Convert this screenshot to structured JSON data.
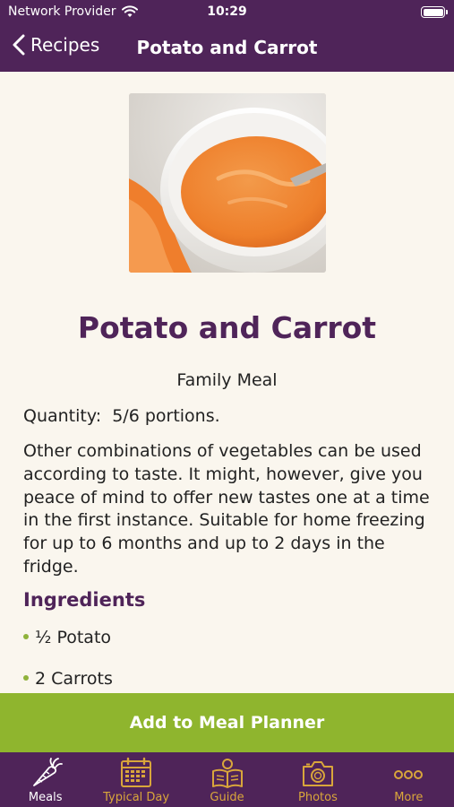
{
  "status_bar": {
    "carrier": "Network Provider",
    "time": "10:29"
  },
  "nav": {
    "back_label": "Recipes",
    "title": "Potato and Carrot"
  },
  "recipe": {
    "title": "Potato and Carrot",
    "category": "Family Meal",
    "quantity": "Quantity:  5/6 portions.",
    "description": "Other combinations of vegetables can be used according to taste. It might, however, give you peace of mind to offer new tastes one at a time in the first instance. Suitable for home freezing for up to 6 months and up to 2 days in the fridge.",
    "ingredients_heading": "Ingredients",
    "ingredients": [
      "½ Potato",
      "2 Carrots"
    ]
  },
  "cta": {
    "label": "Add to Meal Planner"
  },
  "tabs": [
    {
      "label": "Meals",
      "icon": "carrot-icon",
      "active": true
    },
    {
      "label": "Typical Day",
      "icon": "calendar-icon",
      "active": false
    },
    {
      "label": "Guide",
      "icon": "guide-book-icon",
      "active": false
    },
    {
      "label": "Photos",
      "icon": "camera-icon",
      "active": false
    },
    {
      "label": "More",
      "icon": "more-dots-icon",
      "active": false
    }
  ],
  "colors": {
    "brand_purple": "#4f2459",
    "accent_green": "#8fb52e",
    "tab_gold": "#d9a63b",
    "background": "#faf6ee"
  }
}
